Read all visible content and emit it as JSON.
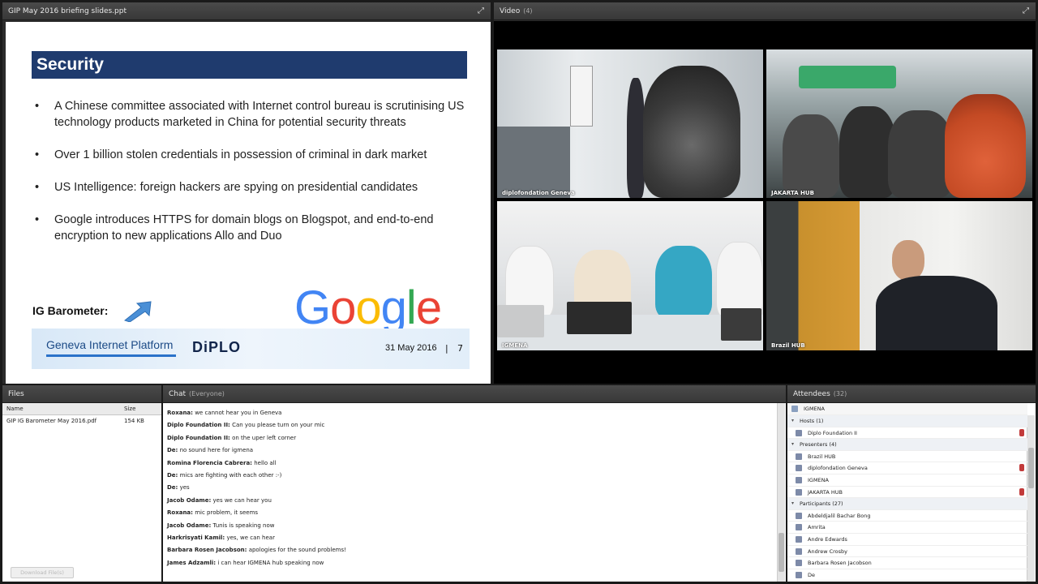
{
  "share": {
    "title": "GIP May 2016 briefing slides.ppt",
    "slide": {
      "heading": "Security",
      "bullets": [
        "A Chinese committee associated with Internet control bureau is scrutinising US technology products marketed in China for potential security threats",
        "Over 1 billion stolen credentials in possession of criminal in dark market",
        "US Intelligence: foreign hackers are spying on presidential candidates",
        "Google introduces HTTPS for domain blogs on Blogspot, and end-to-end encryption to new applications Allo and Duo"
      ],
      "barometer": "IG Barometer:",
      "google": [
        "G",
        "o",
        "o",
        "g",
        "l",
        "e"
      ],
      "footer": {
        "platform": "Geneva Internet Platform",
        "diplo": "DiPLO",
        "date": "31 May 2016",
        "separator": "|",
        "page": "7"
      }
    }
  },
  "video": {
    "title": "Video",
    "count": "(4)",
    "tiles": [
      "diplofondation Geneva",
      "JAKARTA HUB",
      "IGMENA",
      "Brazil HUB"
    ]
  },
  "files": {
    "title": "Files",
    "headers": {
      "name": "Name",
      "size": "Size"
    },
    "rows": [
      {
        "name": "GIP IG Barometer May 2016.pdf",
        "size": "154 KB"
      }
    ],
    "button": "Download File(s)"
  },
  "chat": {
    "title": "Chat",
    "scope": "(Everyone)",
    "messages": [
      {
        "who": "Roxana:",
        "text": "we cannot hear you in Geneva"
      },
      {
        "who": "Diplo Foundation II:",
        "text": "Can you please turn on your mic"
      },
      {
        "who": "Diplo Foundation II:",
        "text": "on the uper left corner"
      },
      {
        "who": "De:",
        "text": "no sound here for igmena"
      },
      {
        "who": "Romina Florencia Cabrera:",
        "text": "hello all"
      },
      {
        "who": "De:",
        "text": "mics are fighting with each other :-)"
      },
      {
        "who": "De:",
        "text": "yes"
      },
      {
        "who": "Jacob Odame:",
        "text": "yes we can hear you"
      },
      {
        "who": "Roxana:",
        "text": "mic problem, it seems"
      },
      {
        "who": "Jacob Odame:",
        "text": "Tunis is speaking now"
      },
      {
        "who": "Harkrisyati Kamil:",
        "text": "yes, we can hear"
      },
      {
        "who": "Barbara Rosen Jacobson:",
        "text": "apologies for the sound problems!"
      },
      {
        "who": "James Adzamli:",
        "text": "i can hear IGMENA hub speaking now"
      }
    ]
  },
  "attendees": {
    "title": "Attendees",
    "count": "(32)",
    "status": "IGMENA",
    "rows": [
      {
        "type": "group",
        "label": "Hosts (1)"
      },
      {
        "type": "person",
        "label": "Diplo Foundation II",
        "mic": true
      },
      {
        "type": "group",
        "label": "Presenters (4)"
      },
      {
        "type": "person",
        "label": "Brazil HUB",
        "mic": false
      },
      {
        "type": "person",
        "label": "diplofondation Geneva",
        "mic": true
      },
      {
        "type": "person",
        "label": "IGMENA",
        "mic": false
      },
      {
        "type": "person",
        "label": "JAKARTA HUB",
        "mic": true
      },
      {
        "type": "group",
        "label": "Participants (27)"
      },
      {
        "type": "person",
        "label": "Abdeldjalil Bachar Bong",
        "mic": false
      },
      {
        "type": "person",
        "label": "Amrita",
        "mic": false
      },
      {
        "type": "person",
        "label": "Andre Edwards",
        "mic": false
      },
      {
        "type": "person",
        "label": "Andrew Crosby",
        "mic": false
      },
      {
        "type": "person",
        "label": "Barbara Rosen Jacobson",
        "mic": false
      },
      {
        "type": "person",
        "label": "De",
        "mic": false
      }
    ]
  },
  "colors": {
    "slide_title_bar": "#1f3b6e",
    "google_blue": "#4285f4",
    "google_red": "#ea4335",
    "google_yellow": "#fbbc05",
    "google_green": "#34a853"
  }
}
